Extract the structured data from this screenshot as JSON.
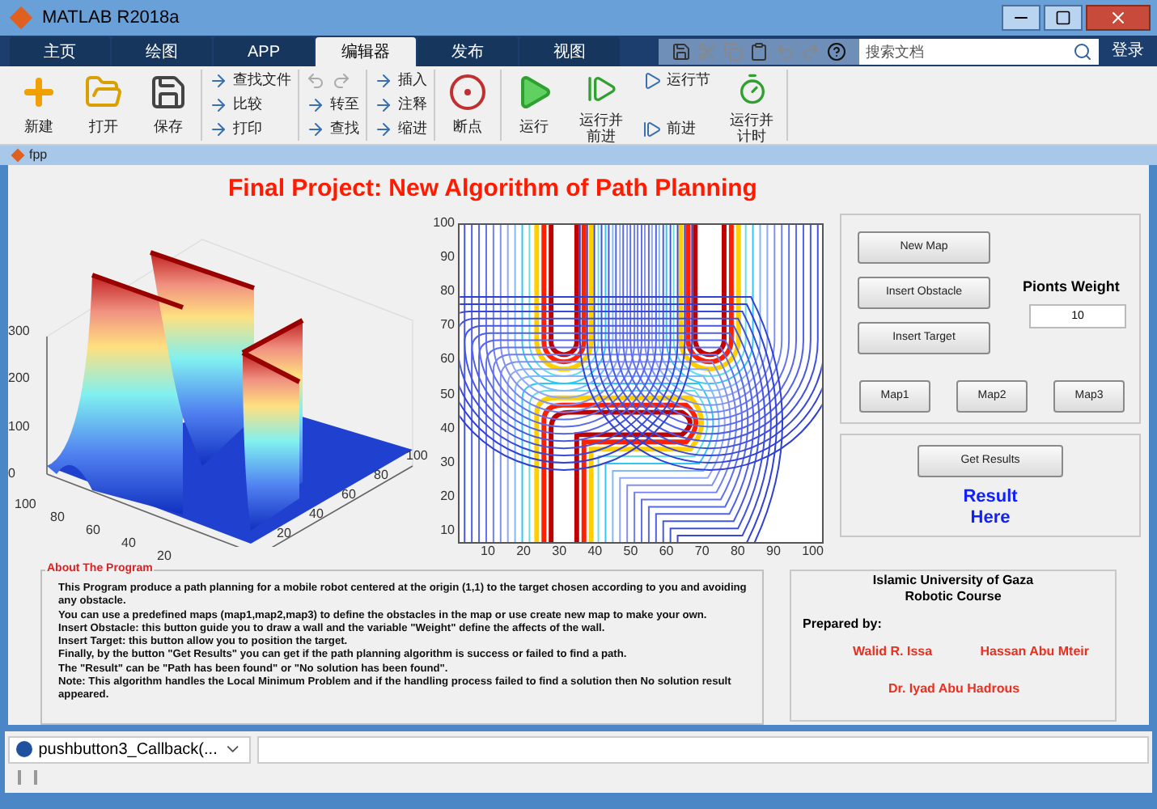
{
  "window": {
    "title": "MATLAB R2018a"
  },
  "tabs": [
    {
      "label": "主页",
      "selected": false
    },
    {
      "label": "绘图",
      "selected": false
    },
    {
      "label": "APP",
      "selected": false
    },
    {
      "label": "编辑器",
      "selected": true
    },
    {
      "label": "发布",
      "selected": false
    },
    {
      "label": "视图",
      "selected": false
    }
  ],
  "search": {
    "placeholder": "搜索文档"
  },
  "login": "登录",
  "toolstrip": [
    {
      "kind": "large",
      "label": [
        "新建"
      ]
    },
    {
      "kind": "large",
      "label": [
        "打开"
      ]
    },
    {
      "kind": "large",
      "label": [
        "保存"
      ]
    },
    {
      "kind": "stack",
      "items": [
        "查找文件",
        "比较",
        "打印"
      ]
    },
    {
      "kind": "stack",
      "items": [
        "转至",
        "查找"
      ]
    },
    {
      "kind": "stack",
      "items": [
        "插入",
        "注释",
        "缩进"
      ]
    },
    {
      "kind": "large",
      "label": [
        "断点"
      ]
    },
    {
      "kind": "large",
      "label": [
        "运行"
      ]
    },
    {
      "kind": "large",
      "label": [
        "运行并",
        "前进"
      ]
    },
    {
      "kind": "stack",
      "items": [
        "运行节",
        "前进"
      ]
    },
    {
      "kind": "large",
      "label": [
        "运行并",
        "计时"
      ]
    }
  ],
  "document": {
    "title": "fpp"
  },
  "figure": {
    "title": "Final Project: New Algorithm of Path Planning",
    "surface_plot": {
      "z_ticks": [
        "300",
        "200",
        "100",
        "0"
      ],
      "left_ticks": [
        "100",
        "80",
        "60",
        "40",
        "20"
      ],
      "right_ticks": [
        "100",
        "80",
        "60",
        "40",
        "20"
      ]
    },
    "contour_plot": {
      "y_ticks": [
        "100",
        "90",
        "80",
        "70",
        "60",
        "50",
        "40",
        "30",
        "20",
        "10"
      ],
      "x_ticks": [
        "10",
        "20",
        "30",
        "40",
        "50",
        "60",
        "70",
        "80",
        "90",
        "100"
      ]
    },
    "map_buttons": [
      "New Map",
      "Insert Obstacle",
      "Insert Target"
    ],
    "weight": {
      "label": "Pionts Weight",
      "value": "10"
    },
    "preset_buttons": [
      "Map1",
      "Map2",
      "Map3"
    ],
    "results_button": "Get Results",
    "result_text": [
      "Result",
      "Here"
    ],
    "about": {
      "title": "About The Program",
      "lines": [
        "This Program produce a path planning for a mobile robot centered at the origin (1,1) to the target chosen according to you and avoiding any obstacle.",
        "You can use a predefined maps (map1,map2,map3) to define the obstacles in the map or use create new map to make your own.",
        "Insert Obstacle: this button guide you to draw a wall and the variable \"Weight\" define the affects of the wall.",
        "Insert Target: this button allow you to position the target.",
        "Finally, by the button \"Get Results\" you can get if the path planning algorithm is success or failed to find a path.",
        "The \"Result\" can be \"Path has been found\"  or  \"No solution has been found\".",
        "Note: This algorithm handles the Local Minimum Problem and if the handling process failed to find a solution then No solution result appeared."
      ]
    },
    "credits": {
      "heading": [
        "Islamic University of Gaza",
        "Robotic Course"
      ],
      "prepared": "Prepared by:",
      "authors": [
        "Walid R. Issa",
        "Hassan Abu Mteir"
      ],
      "supervisor": "Dr. Iyad Abu Hadrous"
    }
  },
  "editor": {
    "function_list": "pushbutton3_Callback(..."
  }
}
